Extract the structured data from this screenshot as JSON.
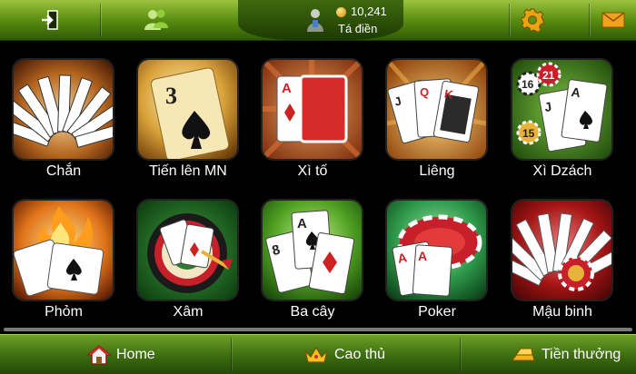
{
  "user": {
    "coins": "10,241",
    "name": "Tá điền"
  },
  "games": [
    {
      "label": "Chắn"
    },
    {
      "label": "Tiến lên MN"
    },
    {
      "label": "Xì tố"
    },
    {
      "label": "Liêng"
    },
    {
      "label": "Xì Dzách"
    },
    {
      "label": "Phỏm"
    },
    {
      "label": "Xâm"
    },
    {
      "label": "Ba cây"
    },
    {
      "label": "Poker"
    },
    {
      "label": "Mậu binh"
    }
  ],
  "card_text": {
    "three": "3",
    "ace": "A",
    "jack": "J",
    "queen": "Q",
    "king": "K",
    "eight": "8",
    "chip16": "16",
    "chip21": "21",
    "chip15": "15"
  },
  "nav": {
    "home": "Home",
    "top": "Cao thủ",
    "bonus": "Tiền thưởng"
  },
  "icons": {
    "exit": "exit-icon",
    "friends": "friends-icon",
    "avatar": "user-avatar-icon",
    "coin": "coin-icon",
    "settings": "gear-icon",
    "mail": "mail-icon",
    "home": "home-icon",
    "crown": "crown-icon",
    "gold": "gold-bar-icon"
  }
}
